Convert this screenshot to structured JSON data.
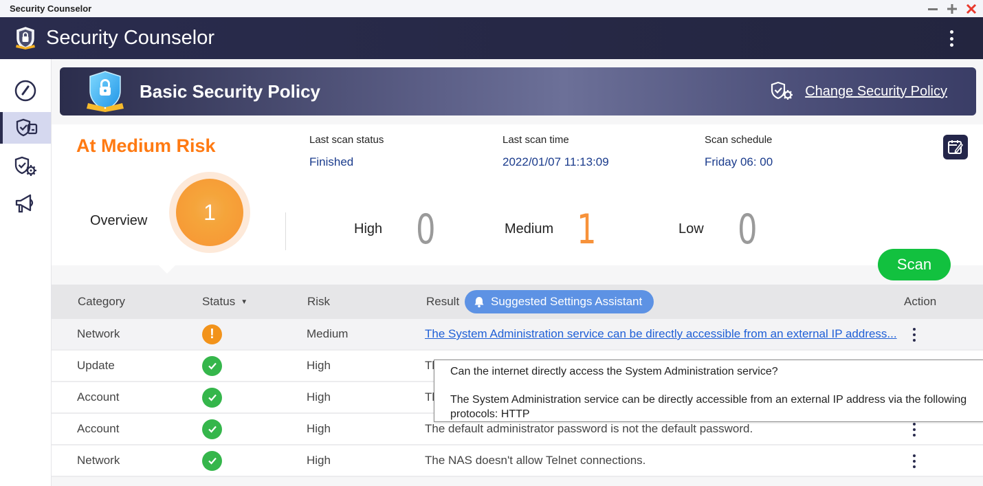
{
  "window": {
    "title": "Security Counselor",
    "controls": {
      "minimize": "—",
      "maximize": "+",
      "close": "✕"
    }
  },
  "header": {
    "app_title": "Security Counselor",
    "menu_icon": "kebab-menu-icon"
  },
  "sidebar": {
    "items": [
      {
        "name": "dashboard",
        "icon": "gauge-icon",
        "active": false
      },
      {
        "name": "security-checkup",
        "icon": "shield-check-card-icon",
        "active": true
      },
      {
        "name": "security-policy",
        "icon": "shield-gear-icon",
        "active": false
      },
      {
        "name": "announcements",
        "icon": "megaphone-icon",
        "active": false
      }
    ]
  },
  "policy": {
    "title": "Basic Security Policy",
    "change_label": "Change Security Policy"
  },
  "summary": {
    "risk_title": "At Medium Risk",
    "risk_color": "#ff7a12",
    "last_scan_status_label": "Last scan status",
    "last_scan_status": "Finished",
    "last_scan_time_label": "Last scan time",
    "last_scan_time": "2022/01/07 11:13:09",
    "scan_schedule_label": "Scan schedule",
    "scan_schedule": "Friday 06: 00",
    "overview_label": "Overview",
    "overview_count": "1",
    "counts": [
      {
        "label": "High",
        "value": "0"
      },
      {
        "label": "Medium",
        "value": "1"
      },
      {
        "label": "Low",
        "value": "0"
      }
    ],
    "scan_button": "Scan",
    "scan_color": "#12c13f"
  },
  "table": {
    "headers": {
      "category": "Category",
      "status": "Status",
      "status_sort": "▼",
      "risk": "Risk",
      "result": "Result",
      "assistant": "Suggested Settings Assistant",
      "action": "Action"
    },
    "rows": [
      {
        "category": "Network",
        "status": "warning",
        "risk": "Medium",
        "result": "The System Administration service can be directly accessible from an external IP address...",
        "link": true
      },
      {
        "category": "Update",
        "status": "ok",
        "risk": "High",
        "result": "Tl",
        "link": false
      },
      {
        "category": "Account",
        "status": "ok",
        "risk": "High",
        "result": "Tl",
        "link": false
      },
      {
        "category": "Account",
        "status": "ok",
        "risk": "High",
        "result": "The default administrator password is not the default password.",
        "link": false
      },
      {
        "category": "Network",
        "status": "ok",
        "risk": "High",
        "result": "The NAS doesn't allow Telnet connections.",
        "link": false
      }
    ]
  },
  "tooltip": {
    "question": "Can the internet directly access the System Administration service?",
    "detail": "The System Administration service can be directly accessible from an external IP address via the following protocols: HTTP"
  }
}
